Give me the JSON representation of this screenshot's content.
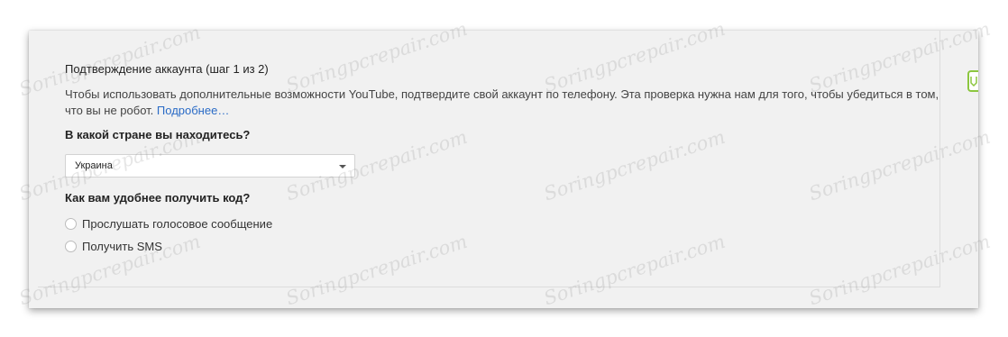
{
  "form": {
    "heading": "Подтверждение аккаунта (шаг 1 из 2)",
    "description": "Чтобы использовать дополнительные возможности YouTube, подтвердите свой аккаунт по телефону. Эта проверка нужна нам для того, чтобы убедиться в том, что вы не робот.",
    "learn_more_link": "Подробнее…",
    "country_question": "В какой стране вы находитесь?",
    "country_select": {
      "selected": "Украина"
    },
    "code_question": "Как вам удобнее получить код?",
    "options": [
      {
        "label": "Прослушать голосовое сообщение",
        "selected": false
      },
      {
        "label": "Получить SMS",
        "selected": false
      }
    ]
  },
  "watermark": {
    "text": "Soringpcrepair.com"
  },
  "colors": {
    "panel_background": "#f1f1f1",
    "link": "#2a6bc6",
    "side_tab_accent": "#8cc63f"
  },
  "icons": {
    "select_arrow": "chevron-down-icon",
    "side_tab": "feedback-icon"
  }
}
